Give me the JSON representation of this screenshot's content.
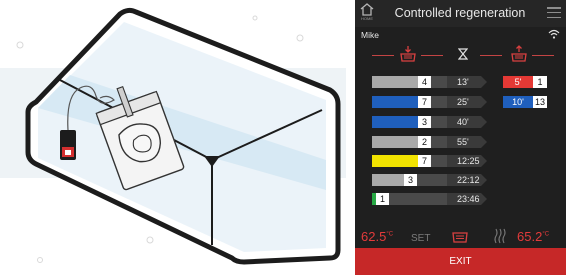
{
  "header": {
    "home_label": "HOME",
    "title": "Controlled regeneration"
  },
  "user": "Mike",
  "rows": [
    {
      "num": "4",
      "time": "13'",
      "fill": 0.78,
      "color": "#a9a9a9"
    },
    {
      "num": "7",
      "time": "25'",
      "fill": 0.78,
      "color": "#1f5fbd"
    },
    {
      "num": "3",
      "time": "40'",
      "fill": 0.78,
      "color": "#1f5fbd"
    },
    {
      "num": "2",
      "time": "55'",
      "fill": 0.78,
      "color": "#a9a9a9"
    },
    {
      "num": "7",
      "time": "12:25",
      "fill": 0.78,
      "color": "#f2e300"
    },
    {
      "num": "3",
      "time": "22:12",
      "fill": 0.6,
      "color": "#a9a9a9"
    },
    {
      "num": "1",
      "time": "23:46",
      "fill": 0.22,
      "color": "#27a844"
    }
  ],
  "side": [
    {
      "value": "5'",
      "num": "1",
      "color": "#e53935"
    },
    {
      "value": "10'",
      "num": "13",
      "color": "#1f5fbd"
    }
  ],
  "bottom": {
    "temp_left": "62.5",
    "temp_left_unit": "°C",
    "set_label": "SET",
    "temp_right": "65.2",
    "temp_right_unit": "°C"
  },
  "exit_label": "EXIT",
  "colors": {
    "accent_red": "#c62828",
    "temp_red": "#e23b3b",
    "panel_bg": "#1f1f1f"
  }
}
